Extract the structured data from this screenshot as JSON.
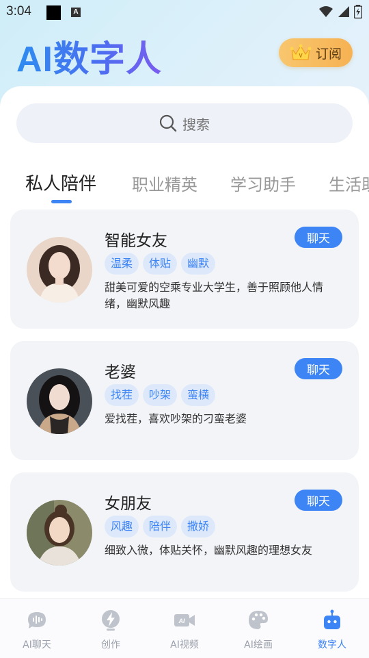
{
  "status_bar": {
    "time": "3:04",
    "a_glyph": "A"
  },
  "header": {
    "title": "AI数字人",
    "subscribe_label": "订阅"
  },
  "search": {
    "placeholder": "搜索"
  },
  "tabs": [
    {
      "label": "私人陪伴",
      "active": true
    },
    {
      "label": "职业精英",
      "active": false
    },
    {
      "label": "学习助手",
      "active": false
    },
    {
      "label": "生活助",
      "active": false
    }
  ],
  "cards": [
    {
      "name": "智能女友",
      "chat_label": "聊天",
      "tags": [
        "温柔",
        "体贴",
        "幽默"
      ],
      "description": "甜美可爱的空乘专业大学生，善于照顾他人情绪，幽默风趣"
    },
    {
      "name": "老婆",
      "chat_label": "聊天",
      "tags": [
        "找茬",
        "吵架",
        "蛮横"
      ],
      "description": "爱找茬，喜欢吵架的刁蛮老婆"
    },
    {
      "name": "女朋友",
      "chat_label": "聊天",
      "tags": [
        "风趣",
        "陪伴",
        "撒娇"
      ],
      "description": "细致入微，体贴关怀，幽默风趣的理想女友"
    }
  ],
  "bottom_nav": [
    {
      "label": "AI聊天",
      "icon": "chat-icon",
      "active": false
    },
    {
      "label": "创作",
      "icon": "lightning-icon",
      "active": false
    },
    {
      "label": "AI视频",
      "icon": "video-icon",
      "active": false
    },
    {
      "label": "AI绘画",
      "icon": "palette-icon",
      "active": false
    },
    {
      "label": "数字人",
      "icon": "robot-icon",
      "active": true
    }
  ],
  "colors": {
    "accent": "#3d84f5",
    "tag_bg": "#dde9fb",
    "subscribe_bg": "#f6b253"
  }
}
